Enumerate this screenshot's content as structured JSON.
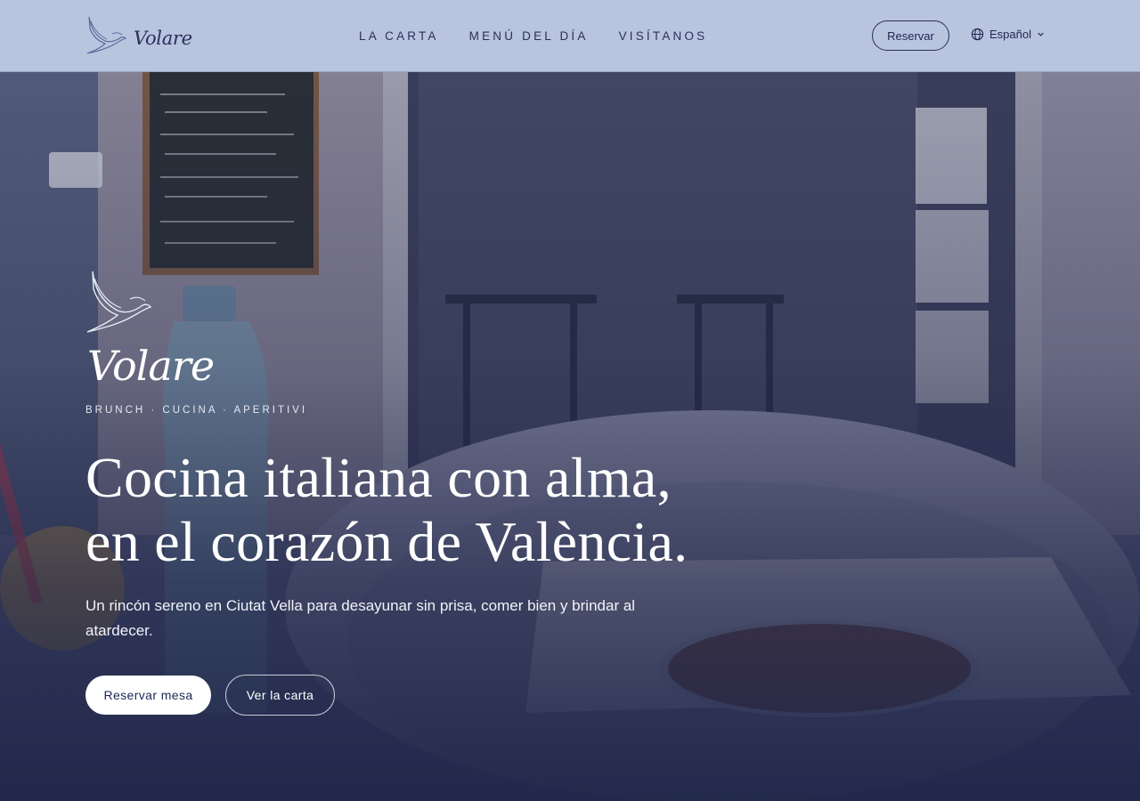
{
  "header": {
    "brand_name": "Volare",
    "nav": [
      {
        "label": "La Carta"
      },
      {
        "label": "Menú del día"
      },
      {
        "label": "Visítanos"
      }
    ],
    "reserve_label": "Reservar",
    "language": {
      "label": "Español",
      "icon": "globe-icon"
    }
  },
  "hero": {
    "brand_name": "Volare",
    "tagline": "BRUNCH · CUCINA · APERITIVI",
    "headline_line1": "Cocina italiana con alma,",
    "headline_line2": "en el corazón de València.",
    "lead": "Un rincón sereno en Ciutat Vella para desayunar sin prisa, comer bien y brindar al atardecer.",
    "primary_cta": "Reservar mesa",
    "secondary_cta": "Ver la carta"
  },
  "colors": {
    "header_bg": "#b9c4df",
    "navy": "#1f2650",
    "hero_overlay": "#1e2547"
  }
}
